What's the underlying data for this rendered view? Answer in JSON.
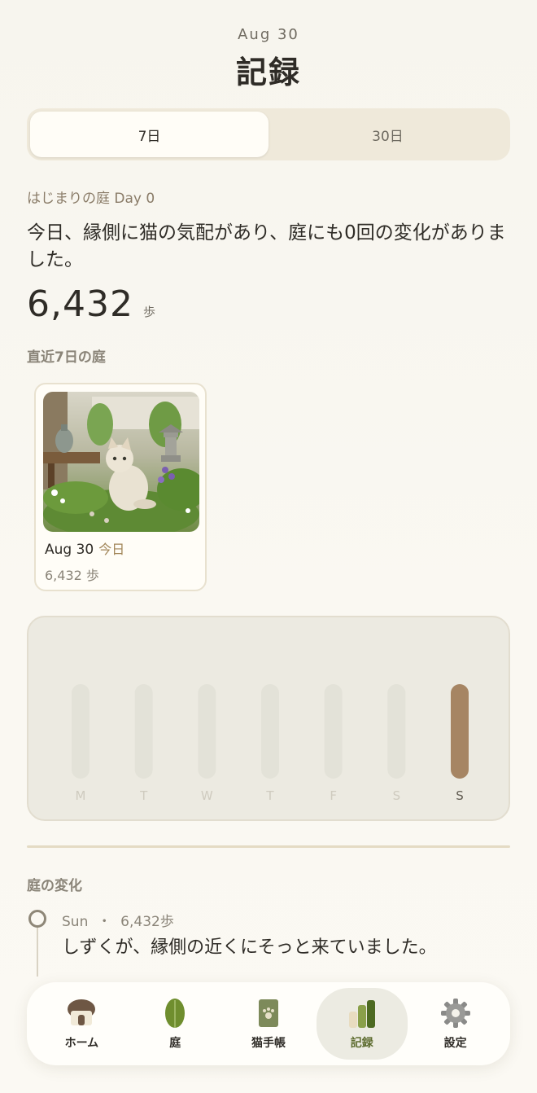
{
  "header": {
    "date": "Aug 30",
    "title": "記録"
  },
  "range_tabs": [
    {
      "label": "7日",
      "active": true
    },
    {
      "label": "30日",
      "active": false
    }
  ],
  "summary": {
    "garden_label": "はじまりの庭 Day 0",
    "message": "今日、縁側に猫の気配があり、庭にも0回の変化がありました。",
    "steps": "6,432",
    "steps_unit": "歩"
  },
  "recent_section": {
    "title": "直近7日の庭",
    "cards": [
      {
        "date": "Aug 30",
        "today_label": "今日",
        "steps": "6,432 歩",
        "image": "garden-cat-illustration"
      }
    ]
  },
  "chart_data": {
    "type": "bar",
    "categories": [
      "M",
      "T",
      "W",
      "T",
      "F",
      "S",
      "S"
    ],
    "values": [
      0,
      0,
      0,
      0,
      0,
      0,
      6432
    ],
    "highlight_color": "#a68563",
    "track_color": "#e3e2d8",
    "grid": false
  },
  "changes_section": {
    "title": "庭の変化",
    "entries": [
      {
        "day": "Sun",
        "separator": "・",
        "steps": "6,432歩",
        "text": "しずくが、縁側の近くにそっと来ていました。"
      }
    ]
  },
  "tabbar": {
    "items": [
      {
        "label": "ホーム",
        "icon": "house-icon",
        "active": false
      },
      {
        "label": "庭",
        "icon": "leaf-icon",
        "active": false
      },
      {
        "label": "猫手帳",
        "icon": "cat-notebook-icon",
        "active": false
      },
      {
        "label": "記録",
        "icon": "bars-icon",
        "active": true
      },
      {
        "label": "設定",
        "icon": "gear-icon",
        "active": false
      }
    ]
  },
  "colors": {
    "accent": "#a68563",
    "active_tab": "#5d6c2f",
    "background": "#f8f6ef"
  }
}
